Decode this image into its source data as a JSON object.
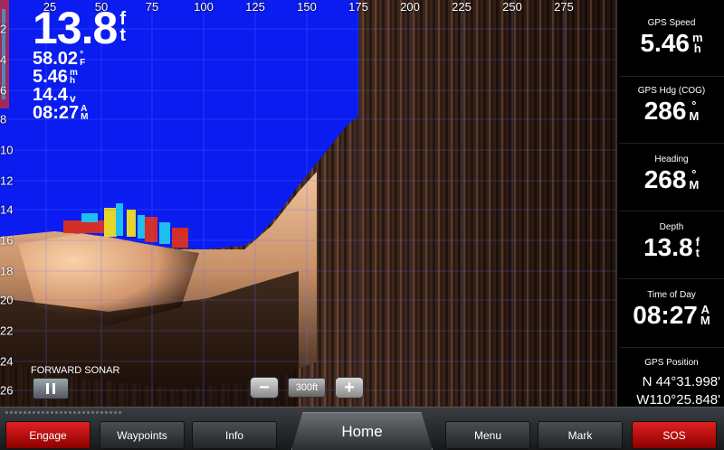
{
  "sonar": {
    "x_ticks": [
      "25",
      "50",
      "75",
      "100",
      "125",
      "150",
      "175",
      "200",
      "225",
      "250",
      "275"
    ],
    "y_ticks": [
      "2",
      "4",
      "6",
      "8",
      "10",
      "12",
      "14",
      "16",
      "18",
      "20",
      "22",
      "24",
      "26"
    ],
    "label": "FORWARD SONAR",
    "zoom_level": "300ft",
    "colors": {
      "water": "#0a1cf0",
      "bottom": "#e8b890",
      "return_red": "#e0301c",
      "return_yellow": "#f0e020",
      "return_cyan": "#20c8f0"
    }
  },
  "overlay": {
    "depth": {
      "value": "13.8",
      "unit": [
        "f",
        "t"
      ]
    },
    "water_temp": {
      "value": "58.02",
      "unit": [
        "°",
        "F"
      ]
    },
    "speed": {
      "value": "5.46",
      "unit": [
        "m",
        "h"
      ]
    },
    "voltage": {
      "value": "14.4",
      "unit": "v"
    },
    "time": {
      "value": "08:27",
      "unit": [
        "A",
        "M"
      ]
    }
  },
  "panel": {
    "gps_speed": {
      "label": "GPS Speed",
      "value": "5.46",
      "unit": [
        "m",
        "h"
      ]
    },
    "gps_heading": {
      "label": "GPS Hdg (COG)",
      "value": "286",
      "unit": [
        "°",
        "M"
      ]
    },
    "heading": {
      "label": "Heading",
      "value": "268",
      "unit": [
        "°",
        "M"
      ]
    },
    "depth": {
      "label": "Depth",
      "value": "13.8",
      "unit": [
        "f",
        "t"
      ]
    },
    "time_of_day": {
      "label": "Time of Day",
      "value": "08:27",
      "unit": [
        "A",
        "M"
      ]
    },
    "gps_position": {
      "label": "GPS Position",
      "lat": "N  44°31.998'",
      "lon": "W110°25.848'"
    }
  },
  "bottom_bar": {
    "engage": "Engage",
    "waypoints": "Waypoints",
    "info": "Info",
    "home": "Home",
    "menu": "Menu",
    "mark": "Mark",
    "sos": "SOS"
  }
}
